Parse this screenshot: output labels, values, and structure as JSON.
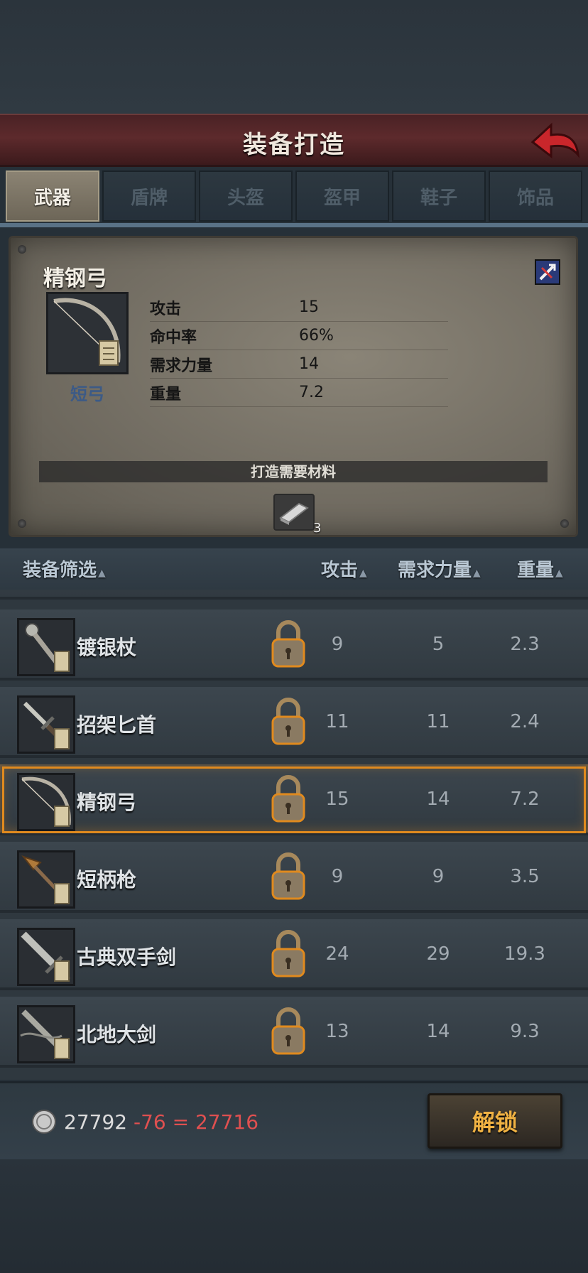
{
  "header": {
    "title": "装备打造"
  },
  "tabs": [
    "武器",
    "盾牌",
    "头盔",
    "盔甲",
    "鞋子",
    "饰品"
  ],
  "detail": {
    "name": "精钢弓",
    "type": "短弓",
    "stats": [
      {
        "label": "攻击",
        "value": "15"
      },
      {
        "label": "命中率",
        "value": "66%"
      },
      {
        "label": "需求力量",
        "value": "14"
      },
      {
        "label": "重量",
        "value": "7.2"
      }
    ],
    "materials_title": "打造需要材料",
    "material_count": "3"
  },
  "filter": {
    "equipment": "装备筛选",
    "attack": "攻击",
    "strength": "需求力量",
    "weight": "重量",
    "sort_glyph": "▲"
  },
  "items": [
    {
      "name": "镀银杖",
      "icon": "staff-icon",
      "attack": "9",
      "strength": "5",
      "weight": "2.3"
    },
    {
      "name": "招架匕首",
      "icon": "dagger-icon",
      "attack": "11",
      "strength": "11",
      "weight": "2.4"
    },
    {
      "name": "精钢弓",
      "icon": "bow-icon",
      "attack": "15",
      "strength": "14",
      "weight": "7.2"
    },
    {
      "name": "短柄枪",
      "icon": "spear-icon",
      "attack": "9",
      "strength": "9",
      "weight": "3.5"
    },
    {
      "name": "古典双手剑",
      "icon": "greatsword-icon",
      "attack": "24",
      "strength": "29",
      "weight": "19.3"
    },
    {
      "name": "北地大剑",
      "icon": "nordic-sword-icon",
      "attack": "13",
      "strength": "14",
      "weight": "9.3"
    }
  ],
  "footer": {
    "balance": "27792",
    "cost": " -76 = 27716",
    "unlock_label": "解锁"
  },
  "colors": {
    "accent": "#e08a1e",
    "cost": "#e05050",
    "button_text": "#f0b243"
  }
}
